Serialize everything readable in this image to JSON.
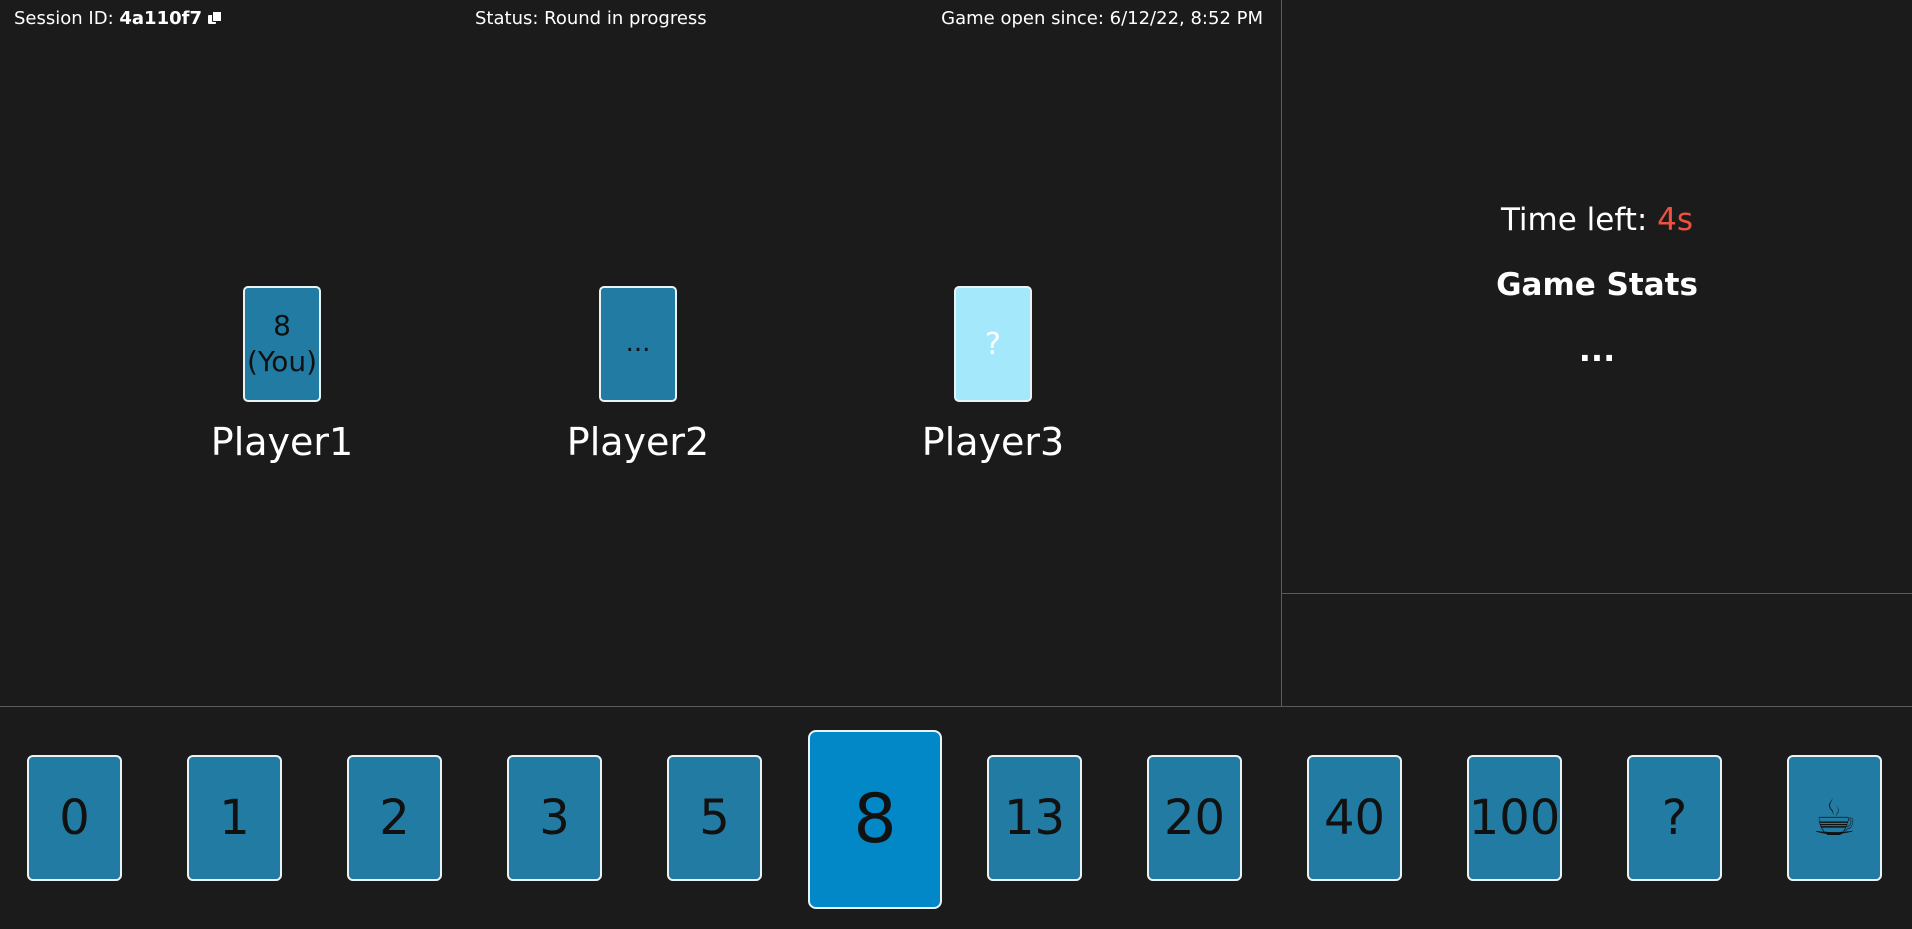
{
  "info_bar": {
    "session_label": "Session ID:",
    "session_id": "4a110f7",
    "status_text": "Status: Round in progress",
    "opened_text": "Game open since: 6/12/22, 8:52 PM"
  },
  "players": [
    {
      "name": "Player1",
      "card_value": "8",
      "card_note": "(You)",
      "state": "played-own"
    },
    {
      "name": "Player2",
      "card_text": "...",
      "state": "pending"
    },
    {
      "name": "Player3",
      "card_text": "?",
      "state": "waiting"
    }
  ],
  "side_panel": {
    "time_label": "Time left:",
    "time_value": "4s",
    "stats_title": "Game Stats",
    "stats_body": "..."
  },
  "hand": {
    "cards": [
      "0",
      "1",
      "2",
      "3",
      "5",
      "8",
      "13",
      "20",
      "40",
      "100",
      "?",
      "☕"
    ],
    "selected": "8"
  },
  "colors": {
    "background": "#1b1b1b",
    "card": "#227ba3",
    "card_selected": "#0288c7",
    "card_waiting": "#a3e9fb",
    "time_value": "#f0503f",
    "divider": "#5a5a5a"
  },
  "icons": {
    "copy": "copy-icon",
    "coffee": "coffee-cup-icon"
  }
}
